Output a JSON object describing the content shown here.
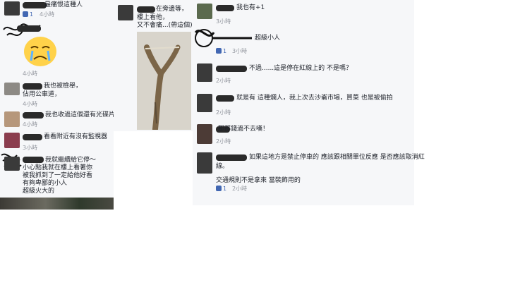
{
  "left": {
    "c0": {
      "text": "最痛恨這種人",
      "likes": "1",
      "time": "4小時"
    },
    "c1": {
      "time": "4小時"
    },
    "c2": {
      "text": "我也被檢舉，",
      "text2": "佔用公車道，",
      "time": "4小時"
    },
    "c3": {
      "text": "我也收過這個還有光碟片",
      "time": "4小時"
    },
    "c4": {
      "text": "看看附近有沒有監視器",
      "time": "3小時"
    },
    "c5": {
      "lines": [
        "我就繼續給它停～",
        "小心點我就在樓上看著你",
        "被我抓到了一定給他好看",
        "有夠卑鄙的小人",
        "超級火大的"
      ]
    }
  },
  "middle": {
    "text": [
      "在旁邊等，",
      "樓上看他，",
      "又不會痛...(帶這個)"
    ]
  },
  "right": {
    "r0": {
      "text": "我也有+1",
      "time": "3小時"
    },
    "r1": {
      "text": "超級小人",
      "likes": "1",
      "time": "3小時"
    },
    "r2": {
      "text": "不過......這是停在紅線上的 不是嗎？",
      "time": "2小時"
    },
    "r3": {
      "text": "就是有 這種爛人，我上次去沙崙市場，買菜 也是被偷拍",
      "time": "2小時"
    },
    "r4": {
      "text": "那那錢過不去嘆！",
      "time": "2小時"
    },
    "r5": {
      "text": "如果這地方是禁止停車的 應該跟相關單位反應 是否應該取消紅",
      "text2": "線。",
      "text3": "交通規則不是拿來 當裝飾用的",
      "likes": "1",
      "time": "2小時"
    }
  },
  "colors": {
    "panel": "#f6f7f9",
    "meta": "#90949c",
    "link": "#4267b2",
    "text": "#1d2129"
  }
}
